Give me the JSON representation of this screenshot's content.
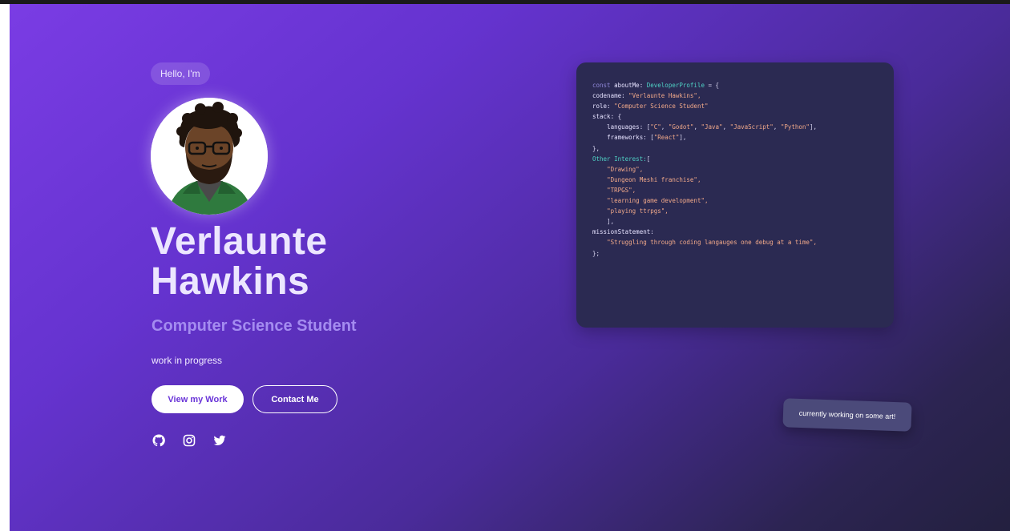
{
  "hero": {
    "greeting": "Hello, I'm",
    "name_first": "Verlaunte",
    "name_last": "Hawkins",
    "role": "Computer Science Student",
    "tagline": "work in progress",
    "primary_button": "View my Work",
    "secondary_button": "Contact Me",
    "socials": [
      "github-icon",
      "instagram-icon",
      "twitter-icon"
    ]
  },
  "code": {
    "l1_kw": "const",
    "l1_var": "aboutMe:",
    "l1_type": "DeveloperProfile",
    "l1_end": "= {",
    "l2_key": "codename:",
    "l2_val": "\"Verlaunte Hawkins\",",
    "l3_key": "role:",
    "l3_val": "\"Computer Science Student\"",
    "l4": "stack: {",
    "l5_key": "languages:",
    "l5_open": "[",
    "l5_items": [
      "\"C\"",
      "\"Godot\"",
      "\"Java\"",
      "\"JavaScript\"",
      "\"Python\""
    ],
    "l5_close": "],",
    "l6_key": "frameworks:",
    "l6_open": "[",
    "l6_val": "\"React\"",
    "l6_close": "],",
    "l7": "},",
    "l8_key": "Other Interest:",
    "l8_open": "[",
    "interests": [
      "\"Drawing\",",
      "\"Dungeon Meshi franchise\",",
      "\"TRPGS\",",
      "\"learning game development\",",
      "\"playing ttrpgs\","
    ],
    "l14": "],",
    "l15_key": "missionStatement:",
    "l16_val": "\"Struggling through coding langauges one debug at a time\",",
    "l17": "};"
  },
  "toast": {
    "text": "currently working on some art!"
  },
  "colors": {
    "gradient_start": "#7a3ce4",
    "gradient_end": "#23203f",
    "role_accent": "#a48cf0",
    "code_bg": "#2b2a52",
    "code_string": "#f0a889",
    "code_type": "#4fd1c5"
  }
}
